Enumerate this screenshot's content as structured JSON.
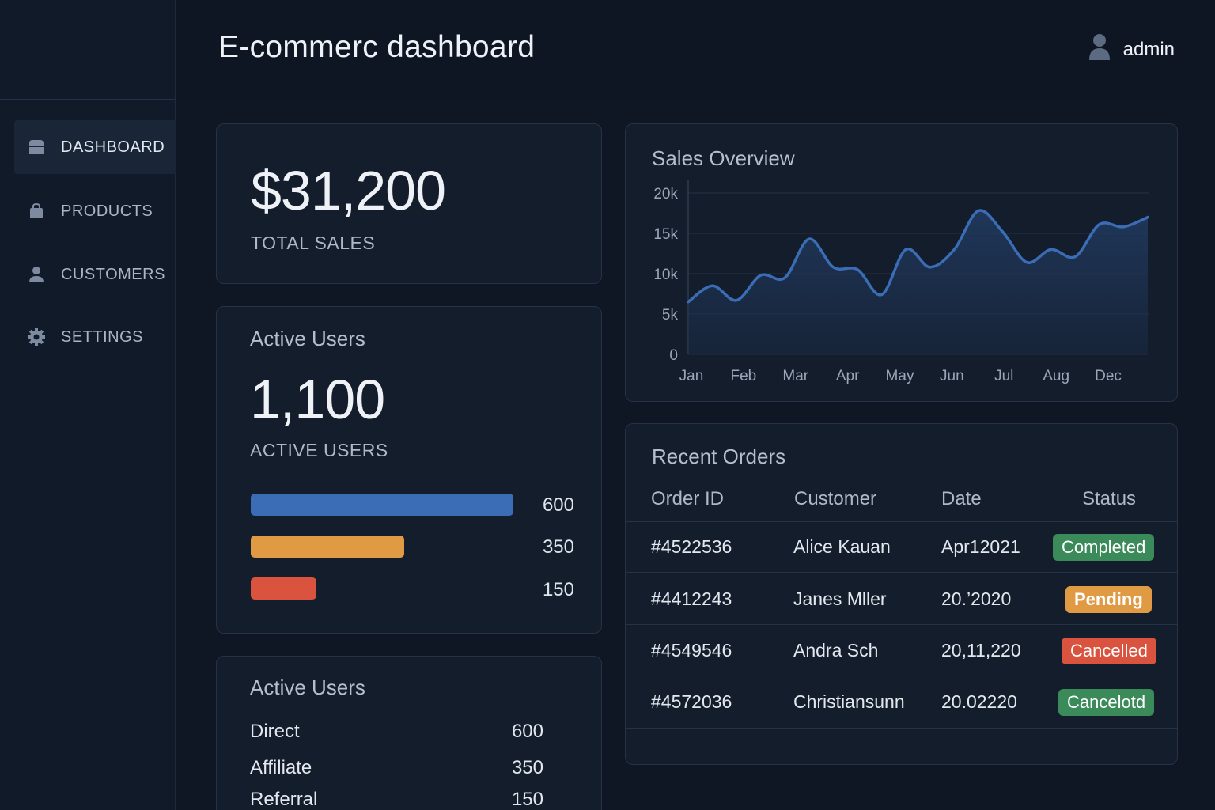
{
  "header": {
    "title": "E-commerc dashboard",
    "user_name": "admin"
  },
  "sidebar": {
    "items": [
      {
        "label": "DASHBOARD",
        "icon": "dashboard-icon",
        "active": true
      },
      {
        "label": "PRODUCTS",
        "icon": "bag-icon",
        "active": false
      },
      {
        "label": "CUSTOMERS",
        "icon": "person-icon",
        "active": false
      },
      {
        "label": "SETTINGS",
        "icon": "gear-icon",
        "active": false
      }
    ]
  },
  "total_sales": {
    "value": "$31,200",
    "label": "TOTAL SALES"
  },
  "active_users": {
    "title": "Active Users",
    "value": "1,100",
    "label": "ACTIVE USERS",
    "bars": [
      {
        "value": 600,
        "display": "600",
        "color": "#3a6db5"
      },
      {
        "value": 350,
        "display": "350",
        "color": "#e09a44"
      },
      {
        "value": 150,
        "display": "150",
        "color": "#d9533f"
      }
    ]
  },
  "active_users_sources": {
    "title": "Active Users",
    "rows": [
      {
        "label": "Direct",
        "value": "600"
      },
      {
        "label": "Affiliate",
        "value": "350"
      },
      {
        "label": "Referral",
        "value": "150"
      }
    ]
  },
  "sales_overview": {
    "title": "Sales Overview"
  },
  "chart_data": {
    "type": "area",
    "title": "Sales Overview",
    "categories": [
      "Jan",
      "Feb",
      "Mar",
      "Apr",
      "May",
      "Jun",
      "Jul",
      "Aug",
      "Dec"
    ],
    "y_ticks": [
      "0",
      "5k",
      "10k",
      "15k",
      "20k"
    ],
    "ylim": [
      0,
      20000
    ],
    "grid": true,
    "line_color": "#3a6db5",
    "series": [
      {
        "values": [
          6500,
          8500,
          6700,
          9800,
          9500,
          14300,
          10800,
          10500,
          7400,
          13000,
          10800,
          13000,
          17800,
          15200,
          11400,
          13000,
          12100,
          16100,
          15800,
          17000
        ]
      }
    ]
  },
  "recent_orders": {
    "title": "Recent Orders",
    "columns": [
      "Order ID",
      "Customer",
      "Date",
      "Status"
    ],
    "rows": [
      {
        "id": "#4522536",
        "customer": "Alice Kauan",
        "date": "Apr12021",
        "status": "Completed",
        "status_color": "#3a8a5a"
      },
      {
        "id": "#4412243",
        "customer": "Janes Mller",
        "date": "20.’2020",
        "status": "Pending",
        "status_color": "#e09a44"
      },
      {
        "id": "#4549546",
        "customer": "Andra Sch",
        "date": "20,11,220",
        "status": "Cancelled",
        "status_color": "#d9533f"
      },
      {
        "id": "#4572036",
        "customer": "Christiansunn",
        "date": "20.02220",
        "status": "Cancelotd",
        "status_color": "#3a8a5a"
      }
    ]
  }
}
